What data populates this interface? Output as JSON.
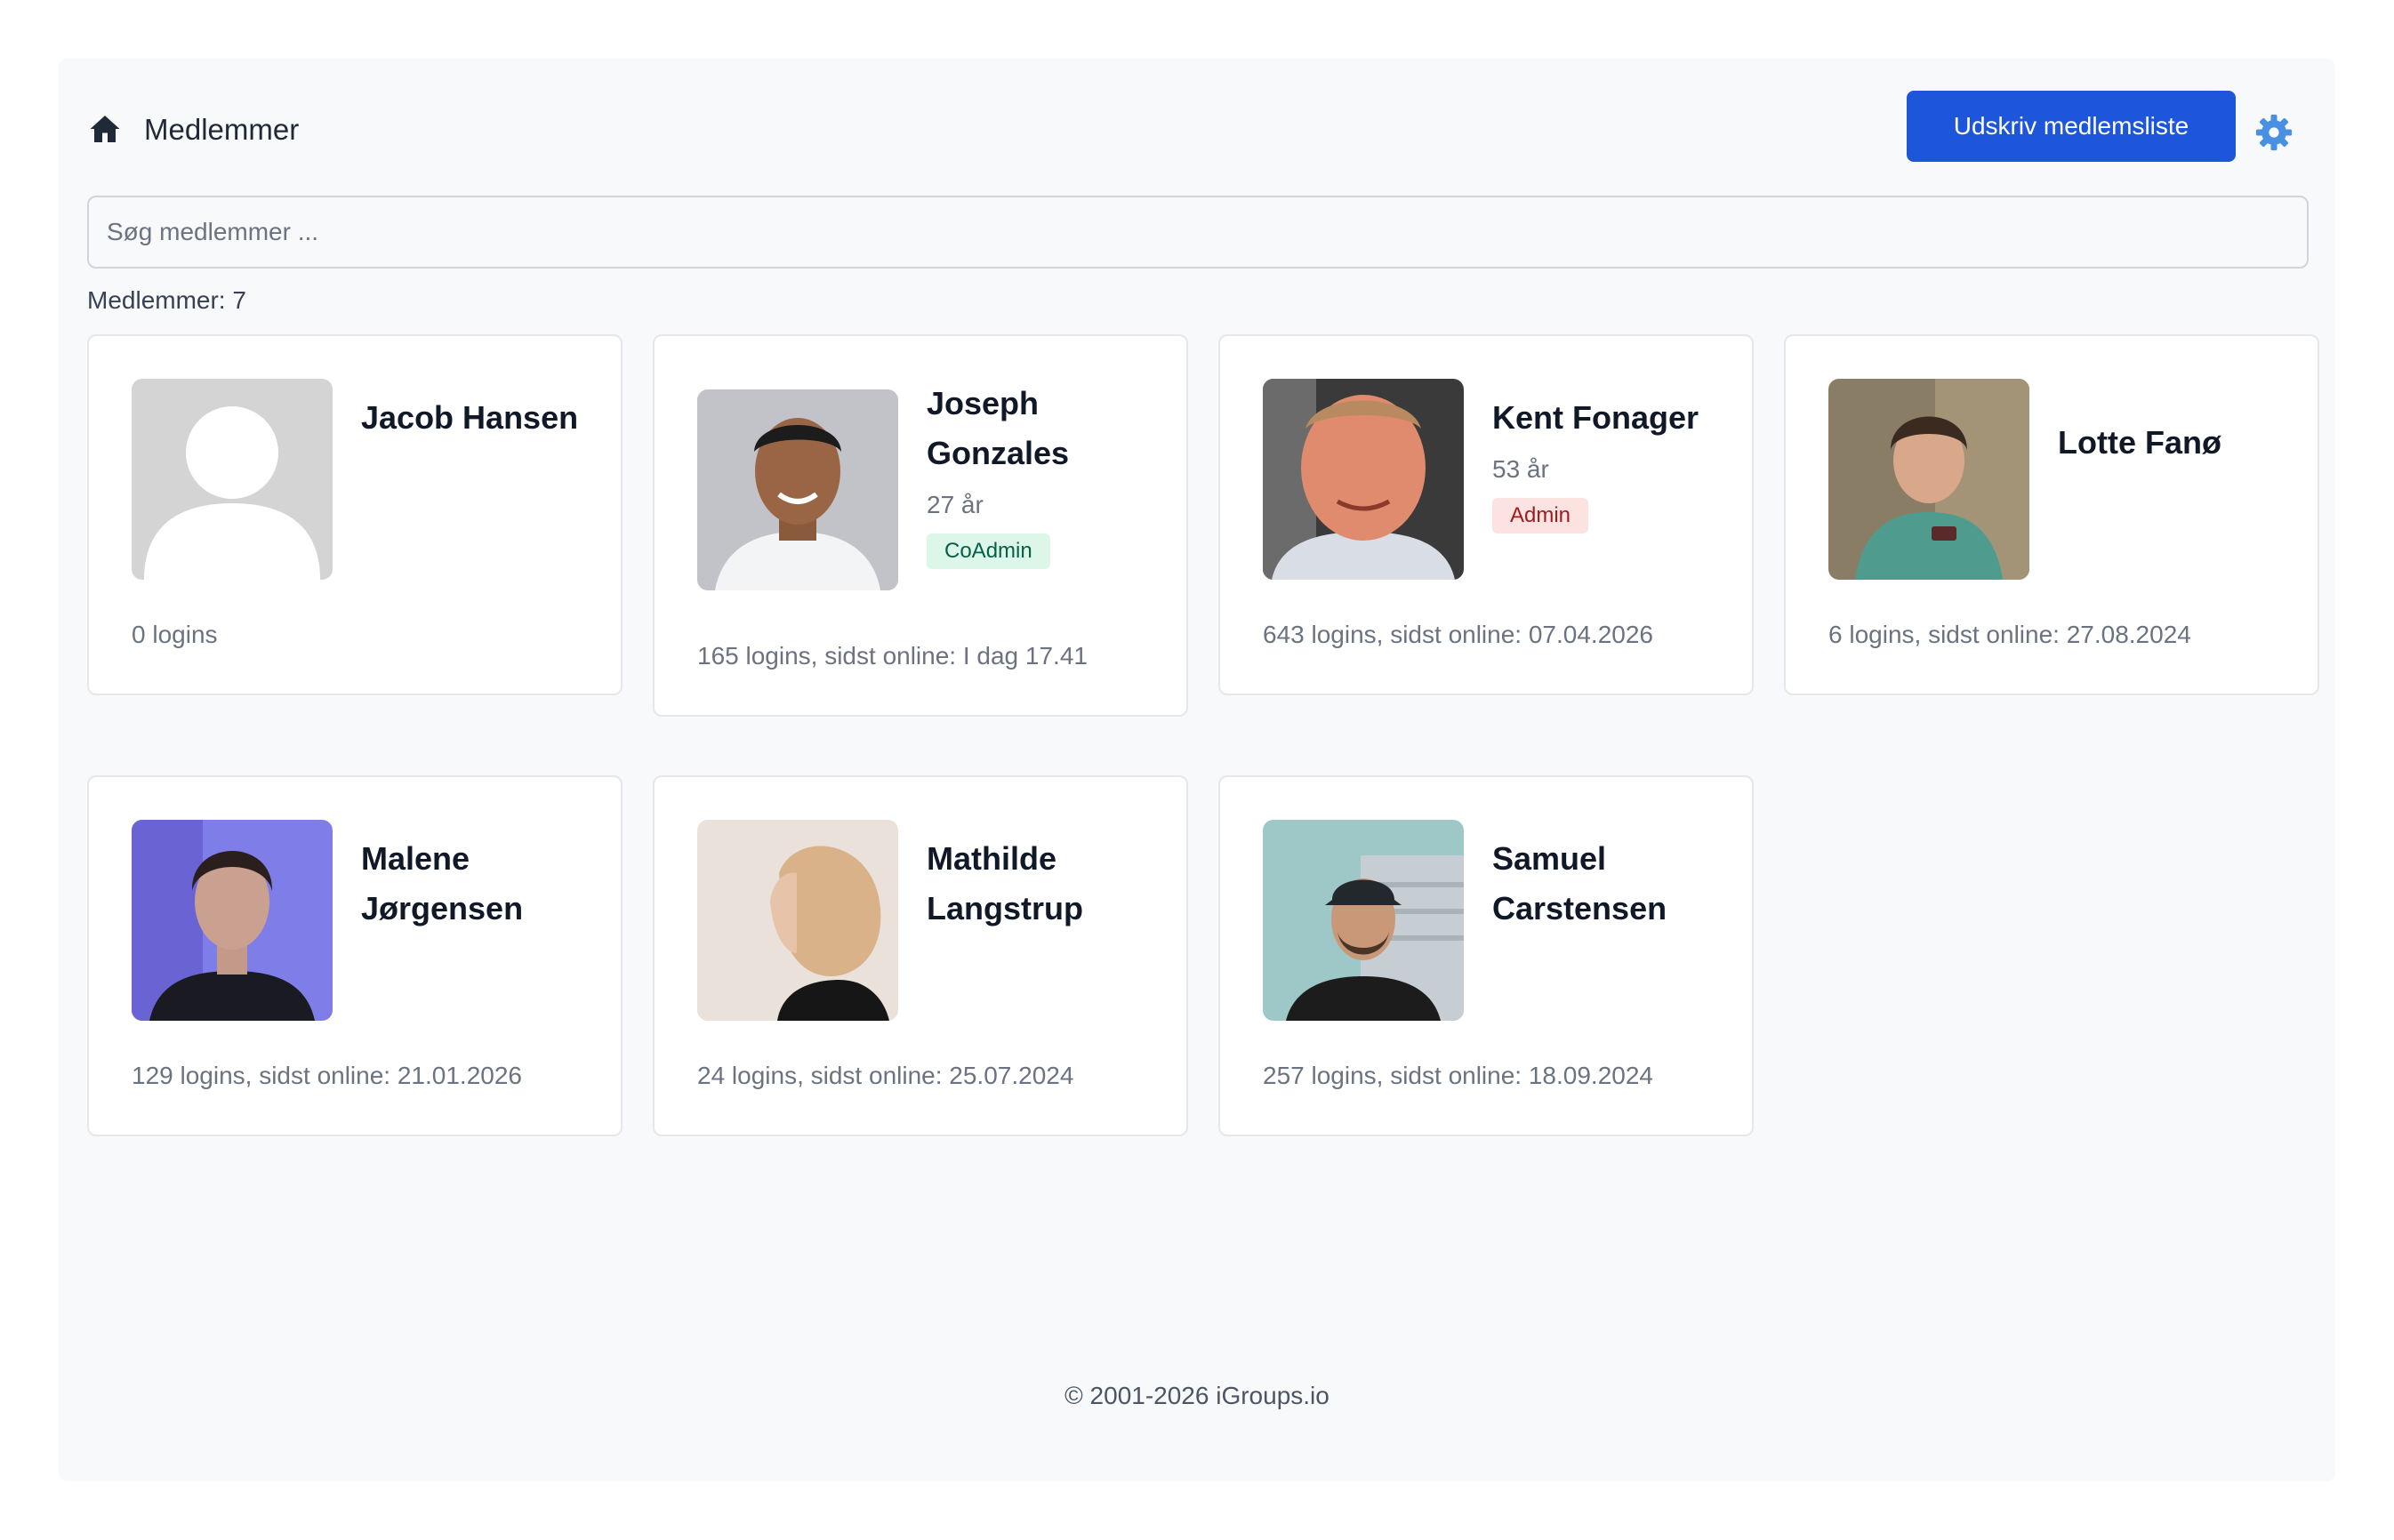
{
  "header": {
    "title": "Medlemmer",
    "print_button": "Udskriv medlemsliste",
    "home_icon": "home-icon",
    "settings_icon": "gear-icon"
  },
  "search": {
    "placeholder": "Søg medlemmer ...",
    "value": ""
  },
  "member_count_label": "Medlemmer: 7",
  "members": [
    {
      "name": "Jacob Hansen",
      "age": "",
      "role": "",
      "stats": "0 logins",
      "avatar": "placeholder-avatar"
    },
    {
      "name": "Joseph Gonzales",
      "age": "27 år",
      "role": "CoAdmin",
      "stats": "165 logins, sidst online: I dag 17.41",
      "avatar": "photo"
    },
    {
      "name": "Kent Fonager",
      "age": "53 år",
      "role": "Admin",
      "stats": "643 logins, sidst online: 07.04.2026",
      "avatar": "photo"
    },
    {
      "name": "Lotte Fanø",
      "age": "",
      "role": "",
      "stats": "6 logins, sidst online: 27.08.2024",
      "avatar": "photo"
    },
    {
      "name": "Malene Jørgensen",
      "age": "",
      "role": "",
      "stats": "129 logins, sidst online: 21.01.2026",
      "avatar": "photo"
    },
    {
      "name": "Mathilde Langstrup",
      "age": "",
      "role": "",
      "stats": "24 logins, sidst online: 25.07.2024",
      "avatar": "photo"
    },
    {
      "name": "Samuel Carstensen",
      "age": "",
      "role": "",
      "stats": "257 logins, sidst online: 18.09.2024",
      "avatar": "photo"
    }
  ],
  "footer": {
    "copyright": "© 2001-2026 iGroups.io"
  },
  "colors": {
    "primary": "#1d56db",
    "gear": "#4a90e2",
    "coadmin_bg": "#dcf7ea",
    "admin_bg": "#fde2e2"
  }
}
